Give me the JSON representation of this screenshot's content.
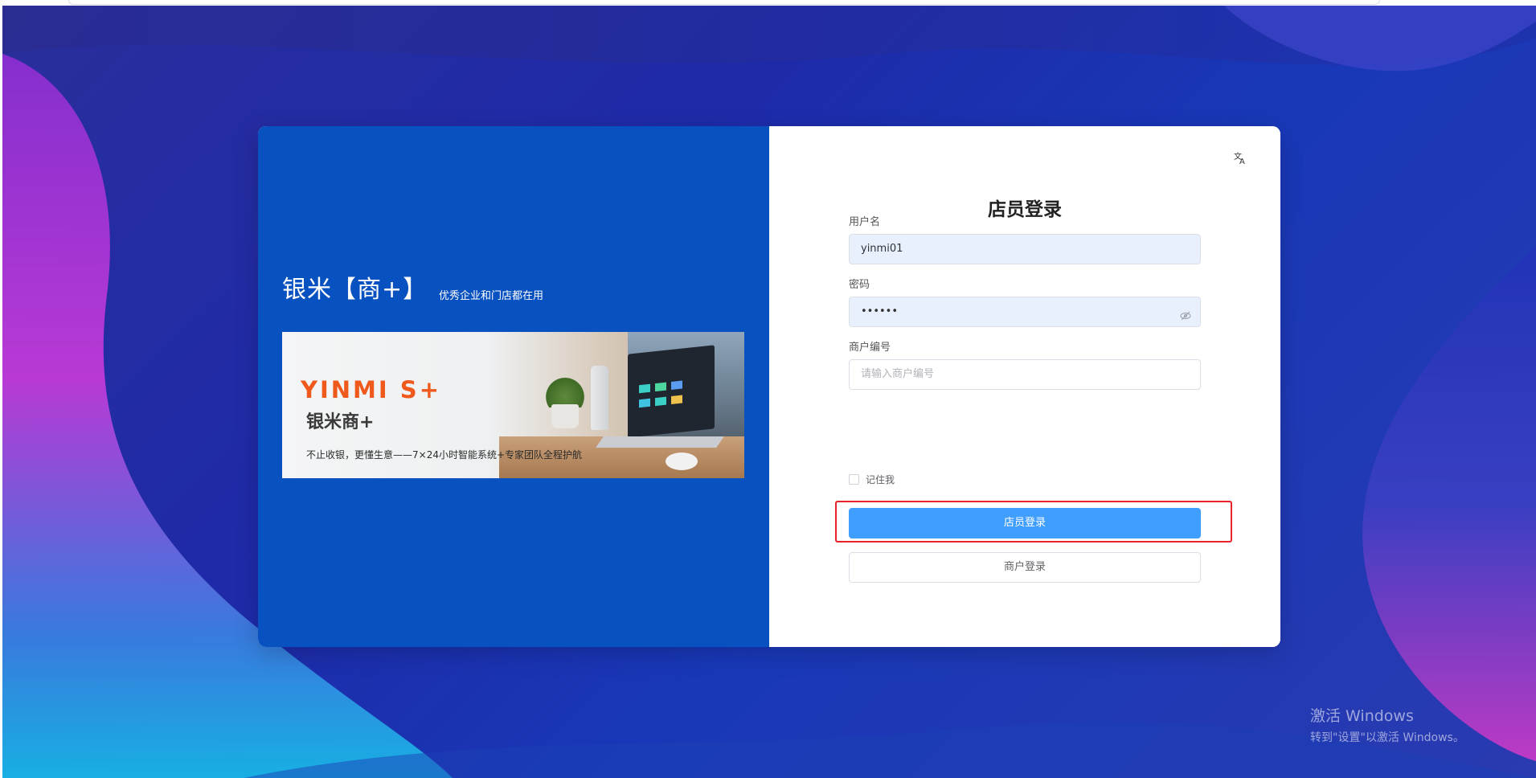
{
  "brand": {
    "title": "银米【商+】",
    "subtitle": "优秀企业和门店都在用"
  },
  "banner": {
    "logo": "YINMI S+",
    "product_name": "银米商+",
    "tagline": "不止收银，更懂生意——7×24小时智能系统+专家团队全程护航"
  },
  "language_icon": "translate-icon",
  "login": {
    "title": "店员登录",
    "username_label": "用户名",
    "username_value": "yinmi01",
    "password_label": "密码",
    "password_value": "••••••",
    "merchant_label": "商户编号",
    "merchant_placeholder": "请输入商户编号",
    "remember_label": "记住我",
    "primary_button": "店员登录",
    "secondary_button": "商户登录"
  },
  "watermark": {
    "line1": "激活 Windows",
    "line2": "转到\"设置\"以激活 Windows。"
  },
  "colors": {
    "card_left": "#0851c1",
    "primary": "#409eff",
    "highlight": "#e8242a"
  }
}
